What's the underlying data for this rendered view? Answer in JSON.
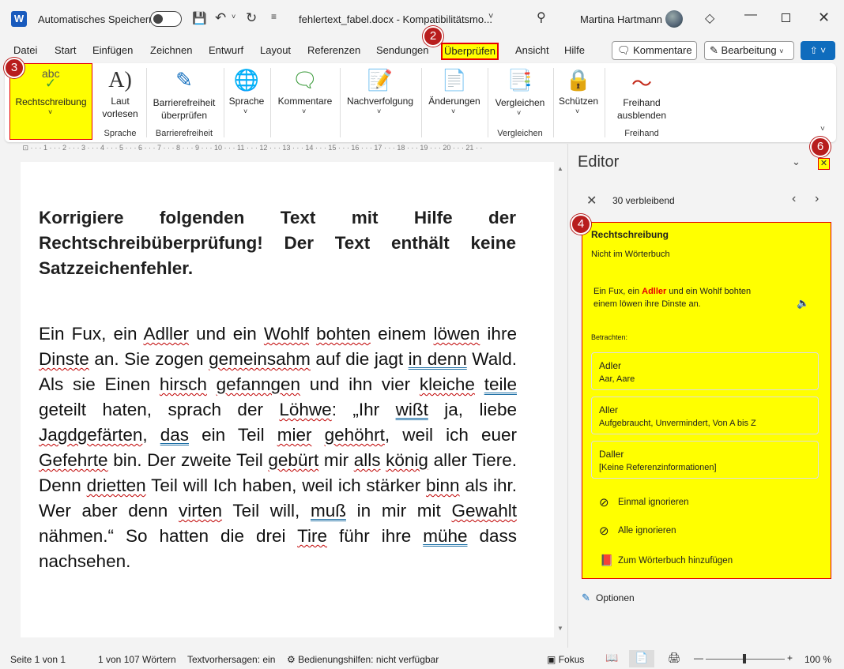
{
  "titlebar": {
    "autosave_label": "Automatisches Speichern",
    "document_title": "fehlertext_fabel.docx  -  Kompatibilitätsmo...",
    "user_name": "Martina Hartmann"
  },
  "menu": {
    "items": [
      "Datei",
      "Start",
      "Einfügen",
      "Zeichnen",
      "Entwurf",
      "Layout",
      "Referenzen",
      "Sendungen",
      "Überprüfen",
      "Ansicht",
      "Hilfe"
    ],
    "comments_button": "Kommentare",
    "editing_button": "Bearbeitung"
  },
  "ribbon": {
    "spelling_icon_text": "abc",
    "spelling": "Rechtschreibung",
    "read_aloud_1": "Laut",
    "read_aloud_2": "vorlesen",
    "group_language_label": "Sprache",
    "accessibility_1": "Barrierefreiheit",
    "accessibility_2": "überprüfen",
    "group_accessibility": "Barrierefreiheit",
    "language": "Sprache",
    "comments": "Kommentare",
    "tracking": "Nachverfolgung",
    "changes": "Änderungen",
    "compare": "Vergleichen",
    "group_compare": "Vergleichen",
    "protect": "Schützen",
    "ink_1": "Freihand",
    "ink_2": "ausblenden",
    "group_ink": "Freihand"
  },
  "badges": {
    "b2": "2",
    "b3": "3",
    "b4": "4",
    "b6": "6"
  },
  "document": {
    "heading": "Korrigiere folgenden Text mit Hilfe der Rechtschreibüberprüfung! Der Text enthält keine Satzzeichenfehler."
  },
  "editor": {
    "title": "Editor",
    "remaining": "30 verbleibend",
    "card_title": "Rechtschreibung",
    "card_subtitle": "Nicht im Wörterbuch",
    "context_before": "Ein Fux, ein ",
    "context_word": "Adller",
    "context_after": " und ein Wohlf bohten einem löwen ihre Dinste an.",
    "consider_label": "Betrachten:",
    "suggestions": [
      {
        "word": "Adler",
        "detail": "Aar, Aare"
      },
      {
        "word": "Aller",
        "detail": "Aufgebraucht, Unvermindert, Von A bis Z"
      },
      {
        "word": "Daller",
        "detail": "[Keine Referenzinformationen]"
      }
    ],
    "ignore_once": "Einmal ignorieren",
    "ignore_all": "Alle ignorieren",
    "add_dictionary": "Zum Wörterbuch hinzufügen",
    "options": "Optionen"
  },
  "statusbar": {
    "page": "Seite 1 von 1",
    "words": "1 von 107 Wörtern",
    "predictions": "Textvorhersagen: ein",
    "accessibility": "Bedienungshilfen: nicht verfügbar",
    "focus": "Fokus",
    "zoom": "100 %"
  },
  "colors": {
    "highlight": "#ffff00",
    "outline": "#e60000",
    "badge": "#b81d1d",
    "accent": "#0f6cbd"
  }
}
